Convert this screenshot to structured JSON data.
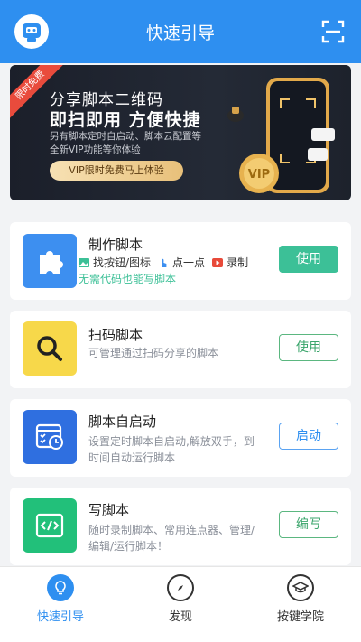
{
  "header": {
    "title": "快速引导"
  },
  "banner": {
    "ribbon": "限时免费",
    "title1": "分享脚本二维码",
    "title2": "即扫即用 方便快捷",
    "sub1": "另有脚本定时自启动、脚本云配置等",
    "sub2": "全新VIP功能等你体验",
    "cta": "VIP限时免费马上体验"
  },
  "cards": [
    {
      "title": "制作脚本",
      "tags": [
        "找按钮/图标",
        "点一点",
        "录制"
      ],
      "desc": "无需代码也能写脚本",
      "button": "使用"
    },
    {
      "title": "扫码脚本",
      "desc": "可管理通过扫码分享的脚本",
      "button": "使用"
    },
    {
      "title": "脚本自启动",
      "desc": "设置定时脚本自启动,解放双手，到时间自动运行脚本",
      "button": "启动"
    },
    {
      "title": "写脚本",
      "desc": "随时录制脚本、常用连点器、管理/编辑/运行脚本！",
      "button": "编写"
    }
  ],
  "tabbar": [
    {
      "label": "快速引导",
      "icon": "lightbulb-icon"
    },
    {
      "label": "发现",
      "icon": "compass-icon"
    },
    {
      "label": "按键学院",
      "icon": "graduation-cap-icon"
    }
  ],
  "colors": {
    "primary": "#2e8ff0",
    "accent_green": "#3cc097",
    "ribbon_red": "#e94b3c"
  }
}
